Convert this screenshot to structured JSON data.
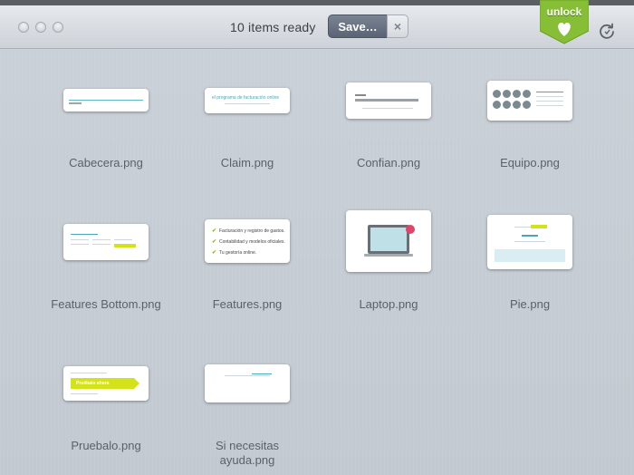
{
  "window": {
    "status_text": "10 items ready",
    "save_label": "Save…",
    "close_symbol": "×",
    "unlock_label": "unlock",
    "accent_green": "#8cc63e"
  },
  "files": [
    {
      "name": "Cabecera.png"
    },
    {
      "name": "Claim.png",
      "thumb_text": "el programa de facturación online"
    },
    {
      "name": "Confian.png"
    },
    {
      "name": "Equipo.png"
    },
    {
      "name": "Features Bottom.png"
    },
    {
      "name": "Features.png",
      "thumb_items": [
        "Facturación y registro de gastos.",
        "Contabilidad y modelos oficiales.",
        "Tu gestoría online."
      ]
    },
    {
      "name": "Laptop.png"
    },
    {
      "name": "Pie.png"
    },
    {
      "name": "Pruebalo.png",
      "thumb_text": "Pruébalo ahora"
    },
    {
      "name": "Si necesitas\nayuda.png"
    }
  ]
}
